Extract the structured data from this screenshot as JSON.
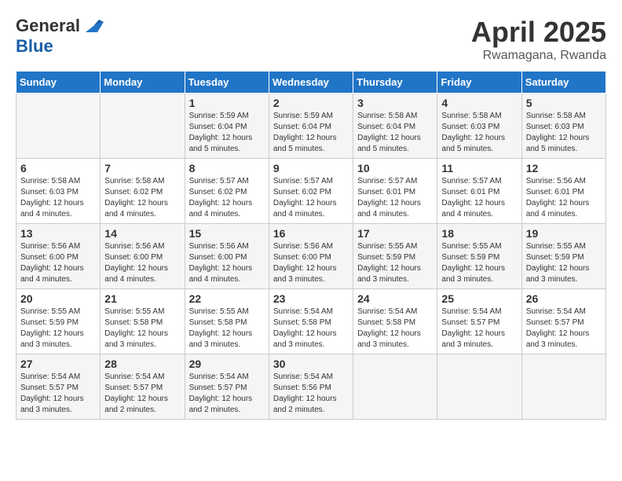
{
  "logo": {
    "general": "General",
    "blue": "Blue"
  },
  "title": {
    "month": "April 2025",
    "location": "Rwamagana, Rwanda"
  },
  "headers": [
    "Sunday",
    "Monday",
    "Tuesday",
    "Wednesday",
    "Thursday",
    "Friday",
    "Saturday"
  ],
  "weeks": [
    [
      {
        "day": "",
        "info": ""
      },
      {
        "day": "",
        "info": ""
      },
      {
        "day": "1",
        "info": "Sunrise: 5:59 AM\nSunset: 6:04 PM\nDaylight: 12 hours\nand 5 minutes."
      },
      {
        "day": "2",
        "info": "Sunrise: 5:59 AM\nSunset: 6:04 PM\nDaylight: 12 hours\nand 5 minutes."
      },
      {
        "day": "3",
        "info": "Sunrise: 5:58 AM\nSunset: 6:04 PM\nDaylight: 12 hours\nand 5 minutes."
      },
      {
        "day": "4",
        "info": "Sunrise: 5:58 AM\nSunset: 6:03 PM\nDaylight: 12 hours\nand 5 minutes."
      },
      {
        "day": "5",
        "info": "Sunrise: 5:58 AM\nSunset: 6:03 PM\nDaylight: 12 hours\nand 5 minutes."
      }
    ],
    [
      {
        "day": "6",
        "info": "Sunrise: 5:58 AM\nSunset: 6:03 PM\nDaylight: 12 hours\nand 4 minutes."
      },
      {
        "day": "7",
        "info": "Sunrise: 5:58 AM\nSunset: 6:02 PM\nDaylight: 12 hours\nand 4 minutes."
      },
      {
        "day": "8",
        "info": "Sunrise: 5:57 AM\nSunset: 6:02 PM\nDaylight: 12 hours\nand 4 minutes."
      },
      {
        "day": "9",
        "info": "Sunrise: 5:57 AM\nSunset: 6:02 PM\nDaylight: 12 hours\nand 4 minutes."
      },
      {
        "day": "10",
        "info": "Sunrise: 5:57 AM\nSunset: 6:01 PM\nDaylight: 12 hours\nand 4 minutes."
      },
      {
        "day": "11",
        "info": "Sunrise: 5:57 AM\nSunset: 6:01 PM\nDaylight: 12 hours\nand 4 minutes."
      },
      {
        "day": "12",
        "info": "Sunrise: 5:56 AM\nSunset: 6:01 PM\nDaylight: 12 hours\nand 4 minutes."
      }
    ],
    [
      {
        "day": "13",
        "info": "Sunrise: 5:56 AM\nSunset: 6:00 PM\nDaylight: 12 hours\nand 4 minutes."
      },
      {
        "day": "14",
        "info": "Sunrise: 5:56 AM\nSunset: 6:00 PM\nDaylight: 12 hours\nand 4 minutes."
      },
      {
        "day": "15",
        "info": "Sunrise: 5:56 AM\nSunset: 6:00 PM\nDaylight: 12 hours\nand 4 minutes."
      },
      {
        "day": "16",
        "info": "Sunrise: 5:56 AM\nSunset: 6:00 PM\nDaylight: 12 hours\nand 3 minutes."
      },
      {
        "day": "17",
        "info": "Sunrise: 5:55 AM\nSunset: 5:59 PM\nDaylight: 12 hours\nand 3 minutes."
      },
      {
        "day": "18",
        "info": "Sunrise: 5:55 AM\nSunset: 5:59 PM\nDaylight: 12 hours\nand 3 minutes."
      },
      {
        "day": "19",
        "info": "Sunrise: 5:55 AM\nSunset: 5:59 PM\nDaylight: 12 hours\nand 3 minutes."
      }
    ],
    [
      {
        "day": "20",
        "info": "Sunrise: 5:55 AM\nSunset: 5:59 PM\nDaylight: 12 hours\nand 3 minutes."
      },
      {
        "day": "21",
        "info": "Sunrise: 5:55 AM\nSunset: 5:58 PM\nDaylight: 12 hours\nand 3 minutes."
      },
      {
        "day": "22",
        "info": "Sunrise: 5:55 AM\nSunset: 5:58 PM\nDaylight: 12 hours\nand 3 minutes."
      },
      {
        "day": "23",
        "info": "Sunrise: 5:54 AM\nSunset: 5:58 PM\nDaylight: 12 hours\nand 3 minutes."
      },
      {
        "day": "24",
        "info": "Sunrise: 5:54 AM\nSunset: 5:58 PM\nDaylight: 12 hours\nand 3 minutes."
      },
      {
        "day": "25",
        "info": "Sunrise: 5:54 AM\nSunset: 5:57 PM\nDaylight: 12 hours\nand 3 minutes."
      },
      {
        "day": "26",
        "info": "Sunrise: 5:54 AM\nSunset: 5:57 PM\nDaylight: 12 hours\nand 3 minutes."
      }
    ],
    [
      {
        "day": "27",
        "info": "Sunrise: 5:54 AM\nSunset: 5:57 PM\nDaylight: 12 hours\nand 3 minutes."
      },
      {
        "day": "28",
        "info": "Sunrise: 5:54 AM\nSunset: 5:57 PM\nDaylight: 12 hours\nand 2 minutes."
      },
      {
        "day": "29",
        "info": "Sunrise: 5:54 AM\nSunset: 5:57 PM\nDaylight: 12 hours\nand 2 minutes."
      },
      {
        "day": "30",
        "info": "Sunrise: 5:54 AM\nSunset: 5:56 PM\nDaylight: 12 hours\nand 2 minutes."
      },
      {
        "day": "",
        "info": ""
      },
      {
        "day": "",
        "info": ""
      },
      {
        "day": "",
        "info": ""
      }
    ]
  ]
}
